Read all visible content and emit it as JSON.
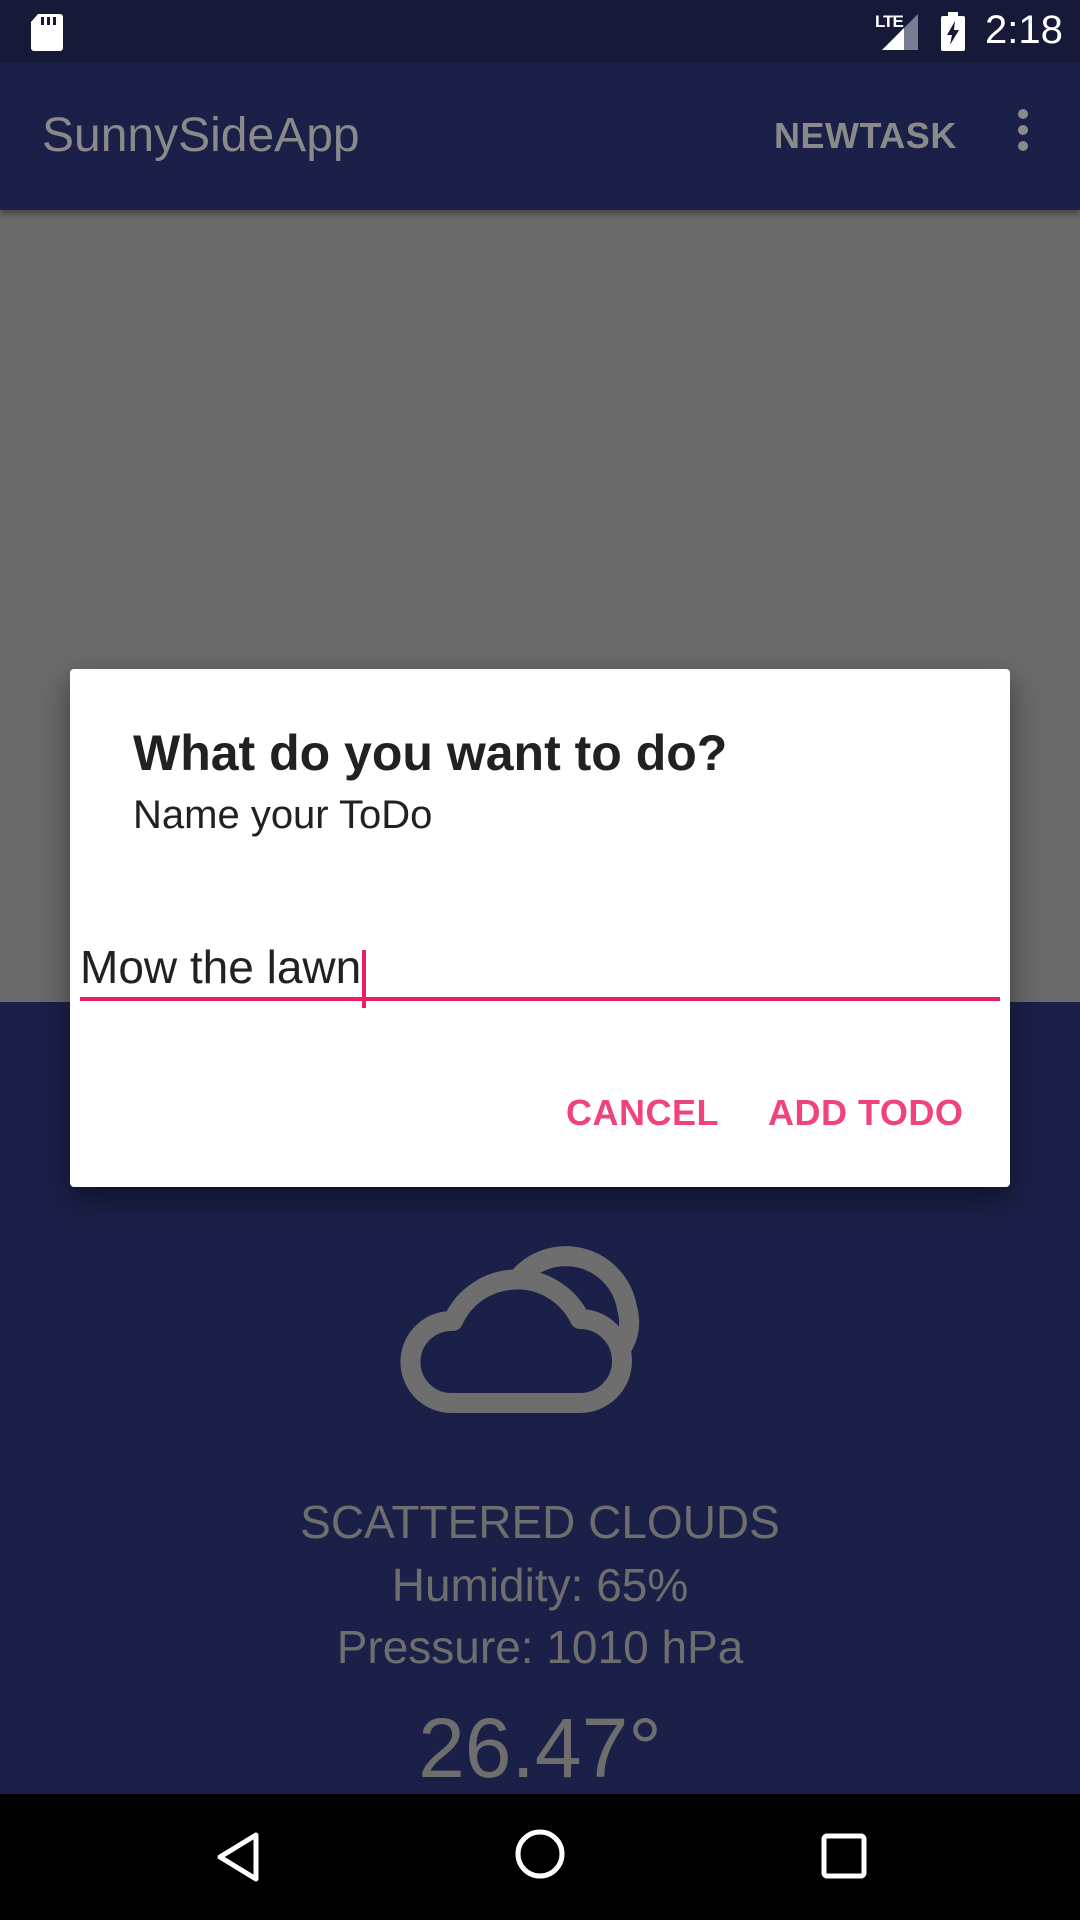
{
  "status_bar": {
    "time": "2:18",
    "network": "LTE",
    "icons": [
      "sd-card-icon",
      "signal-icon",
      "battery-charging-icon"
    ]
  },
  "app_bar": {
    "title": "SunnySideApp",
    "action_label": "NEWTASK",
    "overflow_icon": "more-vert-icon"
  },
  "dialog": {
    "title": "What do you want to do?",
    "subtitle": "Name your ToDo",
    "input_value": "Mow the lawn",
    "cancel_label": "CANCEL",
    "confirm_label": "ADD TODO",
    "accent_color": "#e91e63"
  },
  "weather": {
    "icon": "cloudy-icon",
    "description": "SCATTERED CLOUDS",
    "humidity": "Humidity: 65%",
    "pressure": "Pressure: 1010 hPa",
    "temperature": "26.47°"
  },
  "nav_bar": {
    "icons": [
      "back-icon",
      "home-icon",
      "recents-icon"
    ]
  },
  "colors": {
    "primary": "#1b2049",
    "status_bar": "#161a38",
    "accent": "#e91e63"
  }
}
